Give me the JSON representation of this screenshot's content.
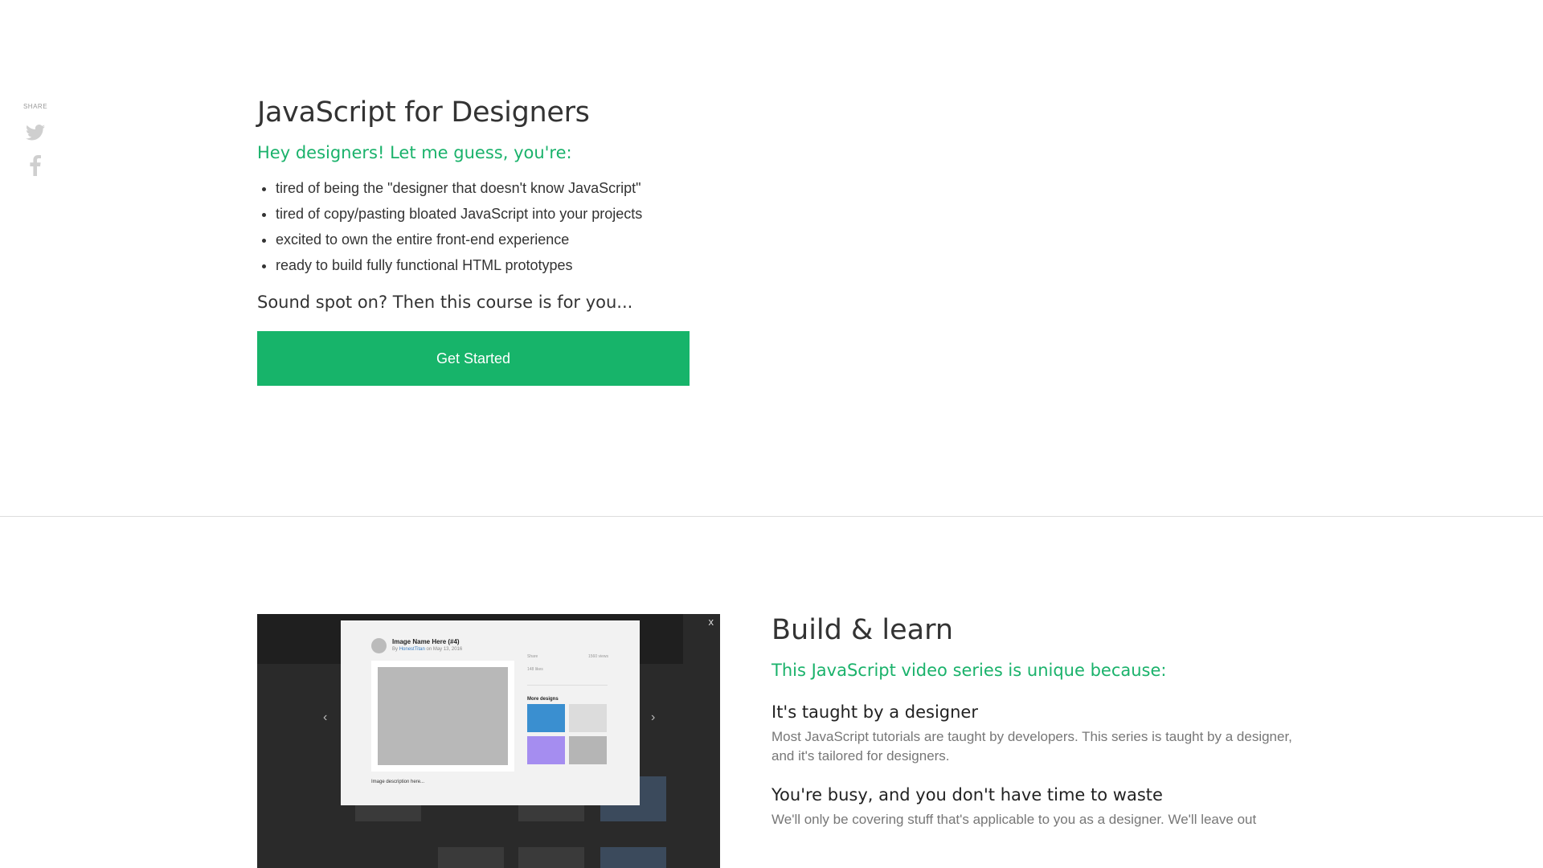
{
  "share": {
    "label": "SHARE",
    "icons": [
      "twitter-icon",
      "facebook-icon"
    ],
    "icon_color": "#cfcfcf"
  },
  "hero": {
    "title": "JavaScript for Designers",
    "subtitle": "Hey designers! Let me guess, you're:",
    "bullets": [
      "tired of being the \"designer that doesn't know JavaScript\"",
      "tired of copy/pasting bloated JavaScript into your projects",
      "excited to own the entire front-end experience",
      "ready to build fully functional HTML prototypes"
    ],
    "lead": "Sound spot on? Then this course is for you...",
    "cta_label": "Get Started"
  },
  "screenshot": {
    "close_label": "x",
    "prev_arrow": "‹",
    "next_arrow": "›",
    "modal": {
      "title": "Image Name Here (#4)",
      "by_prefix": "By",
      "author": "HonestTitan",
      "by_suffix": "on May 13, 2016",
      "share_label": "Share",
      "views_label": "1560 views",
      "likes_label": "148 likes",
      "more_label": "More designs",
      "description": "Image description here...",
      "tile_colors": [
        "#3a8fd0",
        "#dcdcdc",
        "#a58df0",
        "#b5b5b5"
      ]
    }
  },
  "feature": {
    "title": "Build & learn",
    "subtitle": "This JavaScript video series is unique because:",
    "points": [
      {
        "heading": "It's taught by a designer",
        "body": "Most JavaScript tutorials are taught by developers. This series is taught by a designer, and it's tailored for designers."
      },
      {
        "heading": "You're busy, and you don't have time to waste",
        "body": "We'll only be covering stuff that's applicable to you as a designer. We'll leave out"
      }
    ]
  },
  "colors": {
    "accent": "#17b46a",
    "divider": "#dcdcdc",
    "body_text": "#333333",
    "muted_text": "#777777"
  }
}
